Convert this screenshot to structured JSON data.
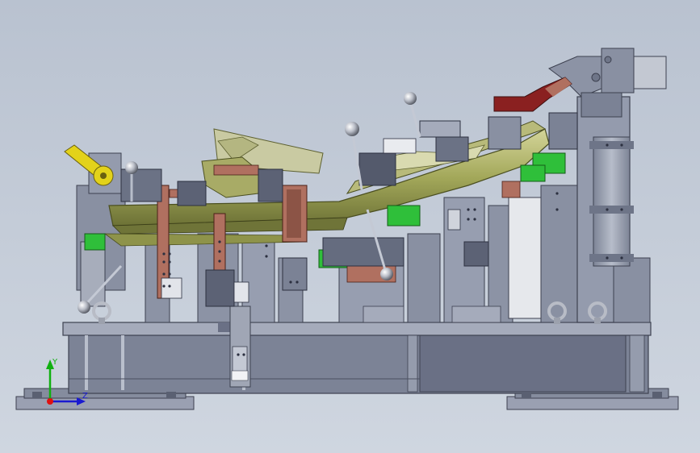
{
  "viewport": {
    "background_top": "#b9c2d0",
    "background_bottom": "#cfd6e0"
  },
  "triad": {
    "y_label": "Y",
    "z_label": "Z",
    "x_color": "#e01010",
    "y_color": "#10b010",
    "z_color": "#1a1ad0"
  },
  "palette": {
    "steel": "#8f96a8",
    "steel_light": "#b9bfcc",
    "steel_dark": "#4a4f60",
    "part_olive": "#8f9648",
    "part_olive_light": "#c7c988",
    "clamp_copper": "#b07060",
    "clamp_red": "#8a2020",
    "pad_green": "#2fbf3a",
    "knob_yellow": "#e3d21a"
  },
  "components": [
    {
      "name": "base-plate"
    },
    {
      "name": "fixture-frame"
    },
    {
      "name": "workpiece-beam"
    },
    {
      "name": "pneumatic-cylinder-right"
    },
    {
      "name": "lifting-eye-bolts"
    },
    {
      "name": "locating-pins"
    },
    {
      "name": "clamp-handles"
    }
  ]
}
